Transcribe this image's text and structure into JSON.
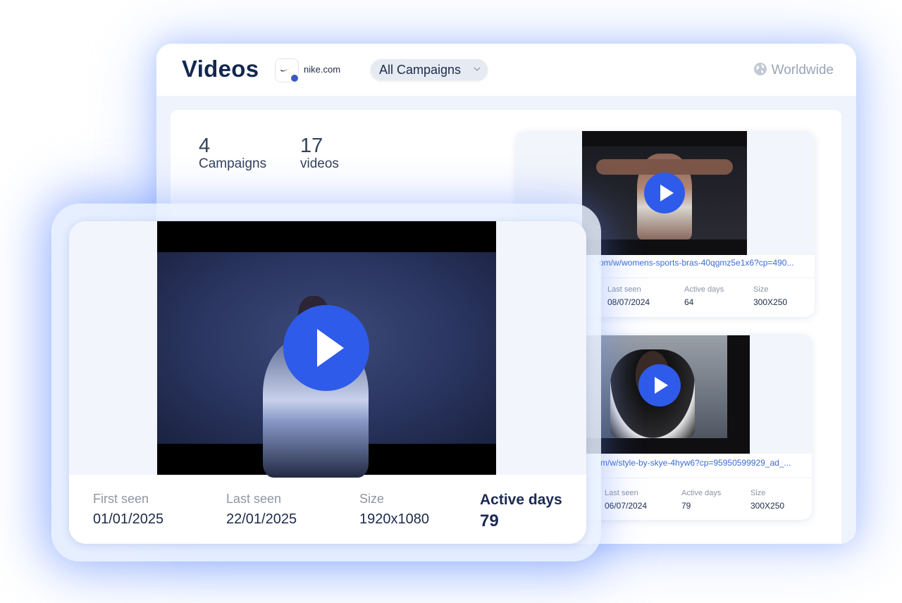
{
  "header": {
    "title": "Videos",
    "domain": "nike.com",
    "campaign_filter": "All Campaigns",
    "region": "Worldwide"
  },
  "stats": {
    "campaigns_count": "4",
    "campaigns_label": "Campaigns",
    "videos_count": "17",
    "videos_label": "videos"
  },
  "video_cards": [
    {
      "url": "om/w/womens-sports-bras-40qgmz5e1x6?cp=490...",
      "last_seen_label": "Last seen",
      "last_seen": "08/07/2024",
      "active_days_label": "Active days",
      "active_days": "64",
      "size_label": "Size",
      "size": "300X250"
    },
    {
      "url": "m/w/style-by-skye-4hyw6?cp=95950599929_ad_...",
      "last_seen_label": "Last seen",
      "last_seen": "06/07/2024",
      "active_days_label": "Active days",
      "active_days": "79",
      "size_label": "Size",
      "size": "300X250"
    }
  ],
  "featured_video": {
    "first_seen_label": "First seen",
    "first_seen": "01/01/2025",
    "last_seen_label": "Last seen",
    "last_seen": "22/01/2025",
    "size_label": "Size",
    "size": "1920x1080",
    "active_days_label": "Active days",
    "active_days": "79"
  },
  "colors": {
    "accent_blue": "#2f5bea",
    "title_navy": "#13284f",
    "link_blue": "#3b6bd6"
  }
}
